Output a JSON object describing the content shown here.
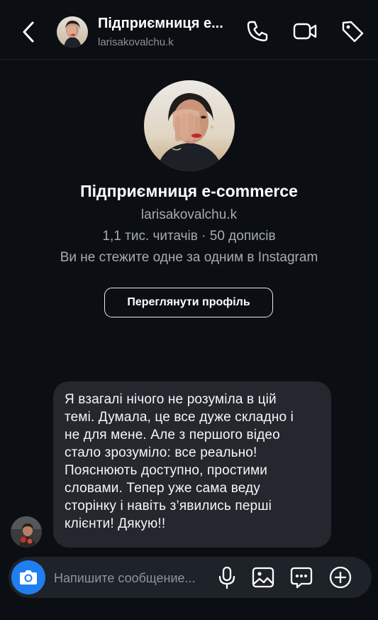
{
  "header": {
    "title": "Підприємниця е...",
    "username": "larisakovalchu.k"
  },
  "profile": {
    "name": "Підприємниця e-commerce",
    "username": "larisakovalchu.k",
    "stats": "1,1 тис. читачів · 50 дописів",
    "follow_status": "Ви не стежите одне за одним в Instagram",
    "view_profile_label": "Переглянути профіль"
  },
  "message": {
    "lines": [
      "Я взагалі нічого не розуміла в цій",
      "темі. Думала, це все дуже складно і",
      "не для мене. Але з першого відео",
      "стало зрозуміло: все реально!",
      "Пояснюють доступно, простими",
      "словами. Тепер уже сама веду",
      "сторінку і навіть з’явились перші",
      "клієнти! Дякую!!"
    ]
  },
  "composer": {
    "placeholder": "Напишите сообщение..."
  },
  "icons": {
    "back": "chevron-left-icon",
    "phone": "phone-icon",
    "video": "video-camera-icon",
    "tag": "tag-icon",
    "camera": "camera-icon",
    "mic": "microphone-icon",
    "gallery": "image-icon",
    "sticker": "chat-bubble-icon",
    "plus": "plus-circle-icon"
  },
  "colors": {
    "background": "#0b0e13",
    "bubble": "#24272e",
    "accent": "#1f7ff0",
    "secondary_text": "#a6abb4"
  }
}
